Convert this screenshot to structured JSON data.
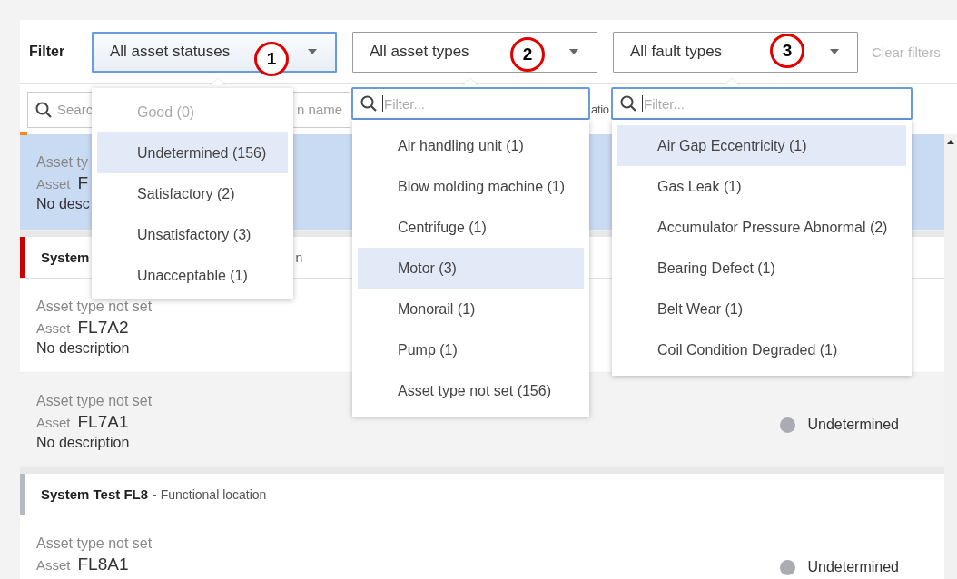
{
  "filter_bar": {
    "label": "Filter",
    "dropdowns": [
      {
        "value": "All asset statuses",
        "focused": true,
        "callout": "1"
      },
      {
        "value": "All asset types",
        "focused": false,
        "callout": "2"
      },
      {
        "value": "All fault types",
        "focused": false,
        "callout": "3"
      }
    ],
    "clear_filters": "Clear filters"
  },
  "search": {
    "placeholder_start": "Searc",
    "placeholder_end": "n name",
    "column_fragment": "atio"
  },
  "list": [
    {
      "kind": "asset",
      "selected": true,
      "shaded": false,
      "asset_type": "Asset ty",
      "asset_label": "Asset",
      "asset_id": "F",
      "description": "No desc"
    },
    {
      "kind": "header",
      "title": "System",
      "subtitle": "n",
      "color": "#cc0000"
    },
    {
      "kind": "asset",
      "selected": false,
      "shaded": false,
      "asset_type": "Asset type not set",
      "asset_label": "Asset",
      "asset_id": "FL7A2",
      "description": "No description"
    },
    {
      "kind": "asset",
      "selected": false,
      "shaded": true,
      "asset_type": "Asset type not set",
      "asset_label": "Asset",
      "asset_id": "FL7A1",
      "description": "No description",
      "status": "Undetermined",
      "color": "#a9acb3"
    },
    {
      "kind": "header",
      "title": "System Test FL8",
      "subtitle": "- Functional location",
      "color": "#b5bac2"
    },
    {
      "kind": "asset",
      "selected": false,
      "shaded": false,
      "asset_type": "Asset type not set",
      "asset_label": "Asset",
      "asset_id": "FL8A1",
      "status": "Undetermined",
      "color": "#a9acb3"
    }
  ],
  "status_menu": {
    "items": [
      {
        "label": "Good (0)",
        "disabled": true,
        "highlighted": false
      },
      {
        "label": "Undetermined (156)",
        "disabled": false,
        "highlighted": true
      },
      {
        "label": "Satisfactory (2)",
        "disabled": false,
        "highlighted": false
      },
      {
        "label": "Unsatisfactory (3)",
        "disabled": false,
        "highlighted": false
      },
      {
        "label": "Unacceptable (1)",
        "disabled": false,
        "highlighted": false
      }
    ]
  },
  "type_menu": {
    "placeholder": "Filter...",
    "items": [
      {
        "label": "Air handling unit (1)",
        "highlighted": false
      },
      {
        "label": "Blow molding machine (1)",
        "highlighted": false
      },
      {
        "label": "Centrifuge (1)",
        "highlighted": false
      },
      {
        "label": "Motor (3)",
        "highlighted": true
      },
      {
        "label": "Monorail (1)",
        "highlighted": false
      },
      {
        "label": "Pump (1)",
        "highlighted": false
      },
      {
        "label": "Asset type not set (156)",
        "highlighted": false
      }
    ]
  },
  "fault_menu": {
    "placeholder": "Filter...",
    "items": [
      {
        "label": "Air Gap Eccentricity (1)",
        "highlighted": true
      },
      {
        "label": "Gas Leak (1)",
        "highlighted": false
      },
      {
        "label": "Accumulator Pressure Abnormal (2)",
        "highlighted": false
      },
      {
        "label": "Bearing Defect (1)",
        "highlighted": false
      },
      {
        "label": "Belt Wear (1)",
        "highlighted": false
      },
      {
        "label": "Coil Condition Degraded (1)",
        "highlighted": false
      }
    ]
  }
}
